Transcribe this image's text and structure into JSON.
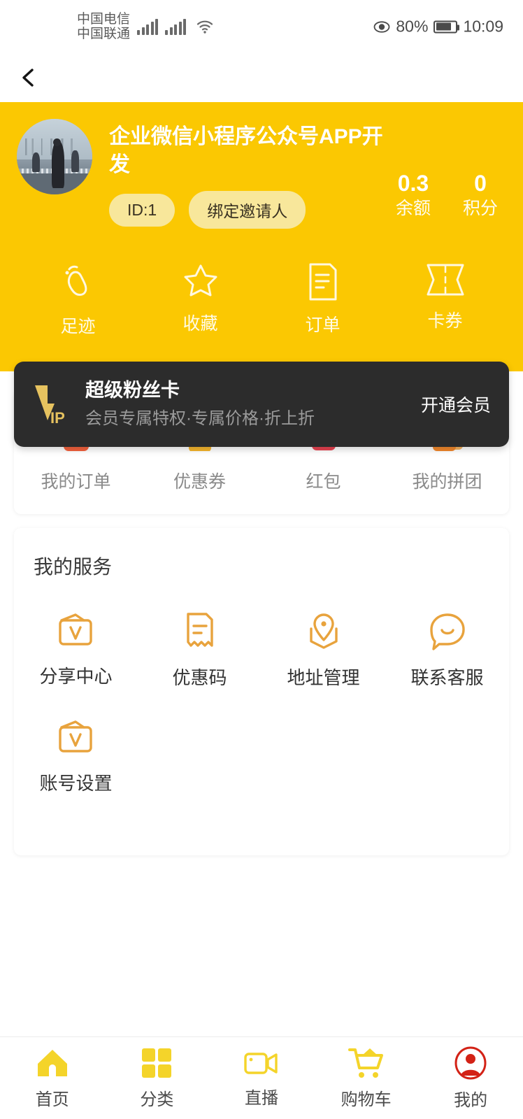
{
  "statusbar": {
    "carrier_top": "中国电信",
    "carrier_bottom": "中国联通",
    "battery_percent": "80%",
    "time": "10:09"
  },
  "header": {
    "username": "企业微信小程序公众号APP开发",
    "id_badge": "ID:1",
    "invite_button": "绑定邀请人",
    "stats": [
      {
        "value": "0.3",
        "label": "余额"
      },
      {
        "value": "0",
        "label": "积分"
      }
    ],
    "quick_actions": [
      {
        "icon": "footprint-icon",
        "label": "足迹"
      },
      {
        "icon": "star-icon",
        "label": "收藏"
      },
      {
        "icon": "order-doc-icon",
        "label": "订单"
      },
      {
        "icon": "ticket-icon",
        "label": "卡券"
      }
    ]
  },
  "vip_card": {
    "logo": "vip-logo-icon",
    "title": "超级粉丝卡",
    "subtitle": "会员专属特权·专属价格·折上折",
    "cta": "开通会员"
  },
  "entry_grid": [
    {
      "icon": "my-orders-icon",
      "label": "我的订单"
    },
    {
      "icon": "coupon-icon",
      "label": "优惠券"
    },
    {
      "icon": "red-packet-icon",
      "label": "红包"
    },
    {
      "icon": "group-buy-icon",
      "label": "我的拼团"
    }
  ],
  "services": {
    "title": "我的服务",
    "items": [
      {
        "icon": "share-center-icon",
        "label": "分享中心"
      },
      {
        "icon": "promo-code-icon",
        "label": "优惠码"
      },
      {
        "icon": "address-pin-icon",
        "label": "地址管理"
      },
      {
        "icon": "customer-service-icon",
        "label": "联系客服"
      },
      {
        "icon": "account-settings-icon",
        "label": "账号设置"
      }
    ]
  },
  "tabbar": [
    {
      "icon": "home-icon",
      "label": "首页",
      "active": false
    },
    {
      "icon": "category-grid-icon",
      "label": "分类",
      "active": false
    },
    {
      "icon": "live-video-icon",
      "label": "直播",
      "active": false
    },
    {
      "icon": "shopping-cart-icon",
      "label": "购物车",
      "active": false
    },
    {
      "icon": "profile-person-icon",
      "label": "我的",
      "active": true
    }
  ],
  "colors": {
    "brand_yellow": "#FBC802",
    "badge_yellow": "#F8E79B",
    "vip_dark": "#2C2C2C",
    "vip_gold": "#E6C25F",
    "service_orange": "#E8A33D",
    "active_red": "#D32216",
    "tab_yellow": "#F4D42A"
  }
}
